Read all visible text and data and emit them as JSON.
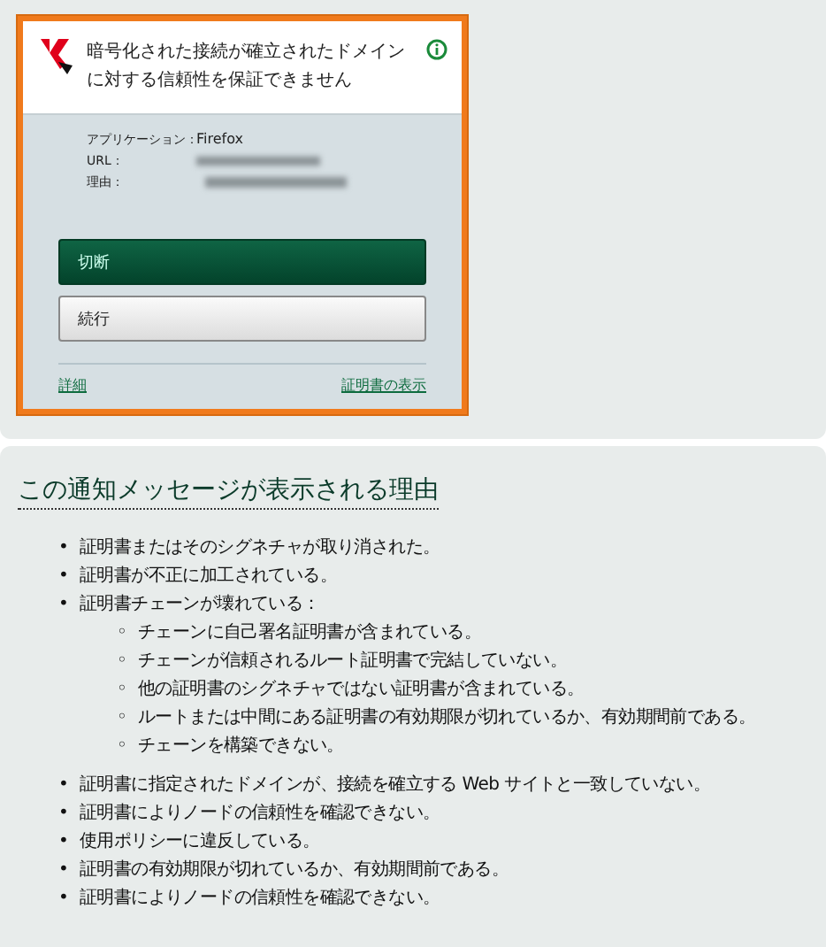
{
  "dialog": {
    "title": "暗号化された接続が確立されたドメインに対する信頼性を保証できません",
    "fields": [
      {
        "label": "アプリケーション：",
        "value": "Firefox",
        "redacted": false
      },
      {
        "label": "URL：",
        "redacted": true
      },
      {
        "label": "理由：",
        "redacted": true
      }
    ],
    "buttons": [
      {
        "label": "切断",
        "primary": true
      },
      {
        "label": "続行",
        "primary": false
      }
    ],
    "links": [
      "詳細",
      "証明書の表示"
    ]
  },
  "section": {
    "heading": "この通知メッセージが表示される理由",
    "reasons": [
      {
        "marker": "•",
        "text": "証明書またはそのシグネチャが取り消された。"
      },
      {
        "marker": "•",
        "text": "証明書が不正に加工されている。"
      },
      {
        "marker": "•",
        "text": "証明書チェーンが壊れている：",
        "children": [
          {
            "marker": "◦",
            "text": "チェーンに自己署名証明書が含まれている。"
          },
          {
            "marker": "◦",
            "text": "チェーンが信頼されるルート証明書で完結していない。"
          },
          {
            "marker": "◦",
            "text": "他の証明書のシグネチャではない証明書が含まれている。"
          },
          {
            "marker": "◦",
            "text": "ルートまたは中間にある証明書の有効期限が切れているか、有効期間前である。"
          },
          {
            "marker": "◦",
            "text": "チェーンを構築できない。"
          }
        ]
      },
      {
        "marker": "•",
        "text": "証明書に指定されたドメインが、接続を確立する Web サイトと一致していない。"
      },
      {
        "marker": "•",
        "text": "証明書によりノードの信頼性を確認できない。"
      },
      {
        "marker": "•",
        "text": "使用ポリシーに違反している。"
      },
      {
        "marker": "•",
        "text": "証明書の有効期限が切れているか、有効期間前である。"
      },
      {
        "marker": "•",
        "text": "証明書によりノードの信頼性を確認できない。"
      }
    ]
  }
}
